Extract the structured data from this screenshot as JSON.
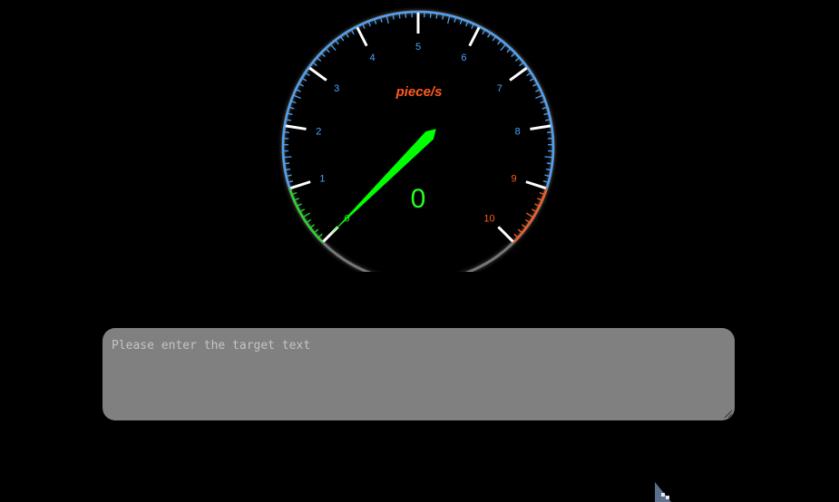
{
  "gauge": {
    "unit_label": "piece/s",
    "value_display": "0",
    "value": 0,
    "min": 0,
    "max": 10,
    "scale_labels": [
      "0",
      "1",
      "2",
      "3",
      "4",
      "5",
      "6",
      "7",
      "8",
      "9",
      "10"
    ],
    "green_zone": [
      0,
      1
    ],
    "red_zone": [
      9,
      10
    ],
    "colors": {
      "arc_blue": "#4aa3ff",
      "zone_green": "#22dd22",
      "zone_red": "#ff5a1e",
      "needle": "#00ff00",
      "value_text": "#22ff22",
      "unit_text": "#ff5a1e",
      "major_tick": "#ffffff"
    }
  },
  "target_input": {
    "placeholder": "Please enter the target text",
    "value": ""
  }
}
